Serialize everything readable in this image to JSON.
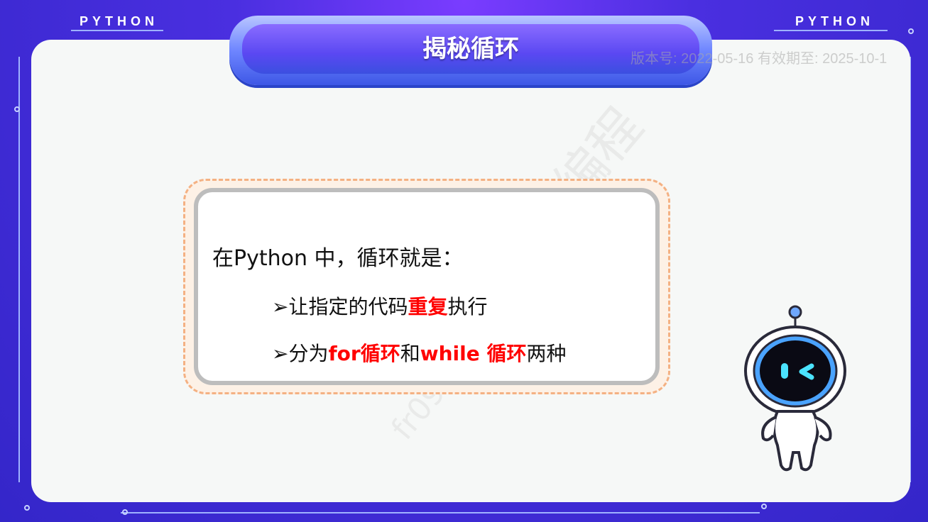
{
  "header": {
    "left_tag": "PYTHON",
    "right_tag": "PYTHON",
    "title": "揭秘循环",
    "version": "版本号: 2022-05-16 有效期至: 2025-10-1"
  },
  "card": {
    "intro": "在Python 中，循环就是：",
    "bullet1": {
      "marker": "➢",
      "prefix": "让指定的代码",
      "highlight": "重复",
      "suffix": "执行"
    },
    "bullet2": {
      "marker": "➢",
      "prefix": "分为",
      "highlight1": "for循环",
      "middle": "和",
      "highlight2": "while 循环",
      "suffix": "两种"
    }
  },
  "watermark": {
    "text": "小码王少儿编程",
    "id": "fr0993688"
  },
  "colors": {
    "highlight": "#ff0000",
    "frame": "#3b2bd6",
    "panel": "#f6f8f7"
  },
  "icons": {
    "mascot": "robot-mascot-icon"
  }
}
